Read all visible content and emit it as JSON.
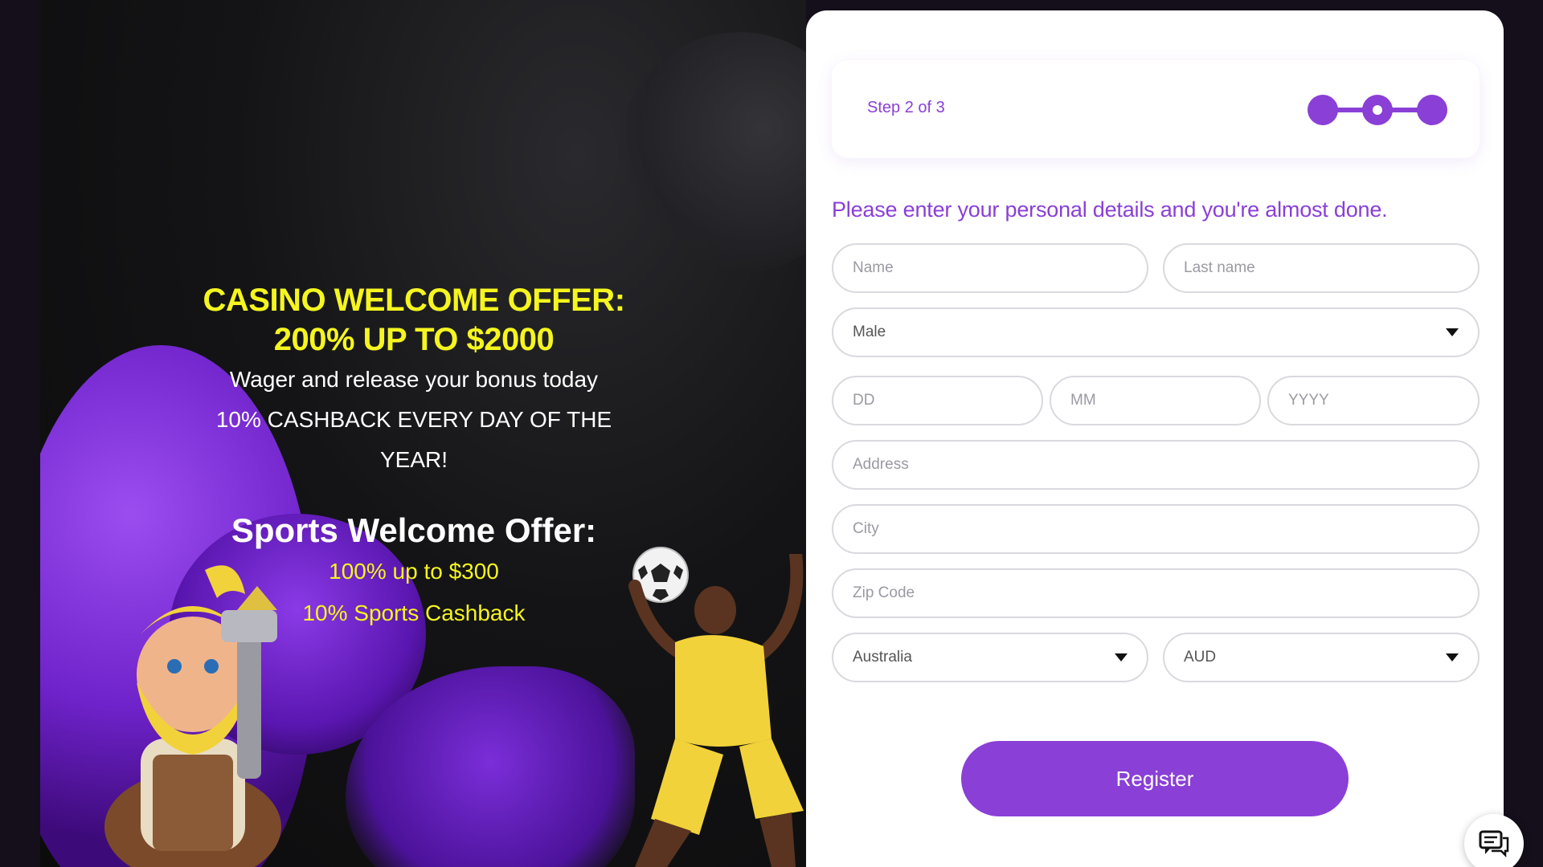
{
  "promo": {
    "casino_title_line1": "CASINO WELCOME OFFER:",
    "casino_title_line2": "200% UP TO $2000",
    "wager_text": "Wager and release your bonus today",
    "cashback_text": "10% CASHBACK EVERY DAY OF THE YEAR!",
    "sports_title": "Sports Welcome Offer:",
    "sports_offer": "100% up to $300",
    "sports_cashback": "10% Sports Cashback"
  },
  "form": {
    "step_label": "Step 2 of 3",
    "stepper": {
      "current_step": 2,
      "total_steps": 3
    },
    "intro": "Please enter your personal details and you're almost done.",
    "name_placeholder": "Name",
    "last_name_placeholder": "Last name",
    "gender_value": "Male",
    "dd_placeholder": "DD",
    "mm_placeholder": "MM",
    "yyyy_placeholder": "YYYY",
    "address_placeholder": "Address",
    "city_placeholder": "City",
    "zip_placeholder": "Zip Code",
    "country_value": "Australia",
    "currency_value": "AUD",
    "register_label": "Register"
  },
  "icons": {
    "stepper": "progress-stepper",
    "caret": "chevron-down-icon",
    "chat": "chat-icon"
  },
  "colors": {
    "accent": "#8a3fd6",
    "promo_yellow": "#f5f51f",
    "page_bg": "#140f1a"
  }
}
